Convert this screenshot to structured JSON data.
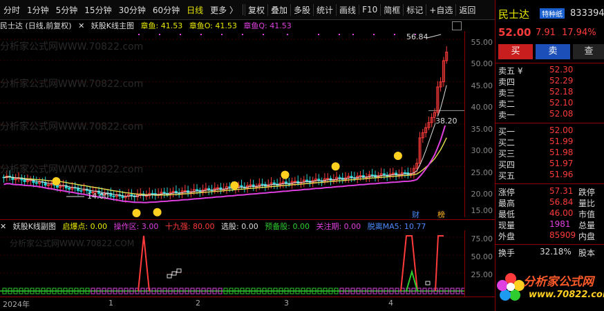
{
  "toolbar": {
    "periods": [
      "分时",
      "1分钟",
      "5分钟",
      "15分钟",
      "30分钟",
      "60分钟",
      "日线",
      "更多 〉"
    ],
    "active_period": "日线",
    "buttons": [
      "复权",
      "叠加",
      "多股",
      "统计",
      "画线",
      "F10",
      "简框",
      "标记",
      "+自选",
      "返回"
    ]
  },
  "main_chart": {
    "stock_label": "民士达 (日线,前复权)",
    "indicator_name": "妖股K线主图",
    "zhangyu": "章鱼: 41.53",
    "zhangyu_o": "章鱼O: 41.53",
    "zhangyu_q": "章鱼Q: 41.53",
    "y_ticks": [
      "55.00",
      "50.00",
      "45.00",
      "40.00",
      "35.00",
      "30.00",
      "25.00",
      "20.00",
      "15.00"
    ],
    "high_label": "56.84",
    "low_label": "14.00",
    "current_line_label": "38.20",
    "badge_cai": "财",
    "badge_bang": "榜",
    "watermark": "分析家公式网WWW.70822.com"
  },
  "sub_chart": {
    "indicator_name": "妖股K线副图",
    "qidian": "启爆点: 0.00",
    "caozuoqu": "操作区: 3.00",
    "shijiuqiang": "十九强: 80.00",
    "xuangu": "选股: 0.00",
    "yubeigu": "预备股: 0.00",
    "guanzhuqi": "关注期: 0.00",
    "tuoli": "脱离MA5: 10.77",
    "y_ticks": [
      "75.00",
      "50.00",
      "25.00"
    ],
    "watermark": "分析家公式网WWW.70822.COM"
  },
  "date_axis": [
    "2024年",
    "1",
    "2",
    "3",
    "4"
  ],
  "panel": {
    "name": "民士达",
    "tag": "特种纸",
    "code": "833394",
    "price": "52.00",
    "change": "7.91",
    "pct": "17.94%",
    "buy": "买",
    "sell": "卖",
    "query": "查",
    "asks": [
      {
        "label": "卖五 ¥",
        "value": "52.30"
      },
      {
        "label": "卖四",
        "value": "52.29"
      },
      {
        "label": "卖三",
        "value": "52.18"
      },
      {
        "label": "卖二",
        "value": "52.10"
      },
      {
        "label": "卖一",
        "value": "52.08"
      }
    ],
    "bids": [
      {
        "label": "买一",
        "value": "52.00"
      },
      {
        "label": "买二",
        "value": "51.99"
      },
      {
        "label": "买三",
        "value": "51.98"
      },
      {
        "label": "买四",
        "value": "51.97"
      },
      {
        "label": "买五",
        "value": "51.96"
      }
    ],
    "stats": [
      {
        "label": "涨停",
        "value": "57.31",
        "label2": "跌停",
        "green": false
      },
      {
        "label": "最高",
        "value": "56.84",
        "label2": "量比",
        "green": false
      },
      {
        "label": "最低",
        "value": "46.00",
        "label2": "市值",
        "green": false
      },
      {
        "label": "现量",
        "value": "1981",
        "label2": "总量",
        "green": true
      },
      {
        "label": "外盘",
        "value": "85909",
        "label2": "内盘",
        "green": false
      }
    ],
    "turnover_label": "换手",
    "turnover_value": "32.18%",
    "turnover_label2": "股本",
    "logo_text": "分析家公式网",
    "logo_url": "www.70822.com"
  }
}
